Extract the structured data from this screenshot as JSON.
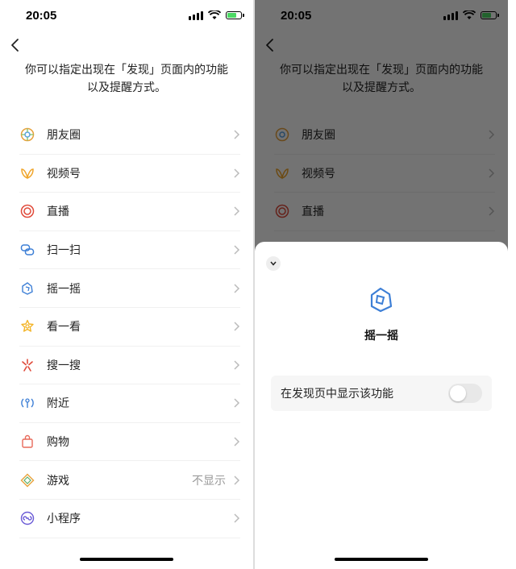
{
  "status_bar": {
    "time": "20:05"
  },
  "description": {
    "line1": "你可以指定出现在「发现」页面内的功能",
    "line2": "以及提醒方式。"
  },
  "features": [
    {
      "label": "朋友圈",
      "icon": "moments-icon",
      "value": ""
    },
    {
      "label": "视频号",
      "icon": "channels-icon",
      "value": ""
    },
    {
      "label": "直播",
      "icon": "live-icon",
      "value": ""
    },
    {
      "label": "扫一扫",
      "icon": "scan-icon",
      "value": ""
    },
    {
      "label": "摇一摇",
      "icon": "shake-icon",
      "value": ""
    },
    {
      "label": "看一看",
      "icon": "top-stories-icon",
      "value": ""
    },
    {
      "label": "搜一搜",
      "icon": "search-icon",
      "value": ""
    },
    {
      "label": "附近",
      "icon": "nearby-icon",
      "value": ""
    },
    {
      "label": "购物",
      "icon": "shopping-icon",
      "value": ""
    },
    {
      "label": "游戏",
      "icon": "games-icon",
      "value": "不显示"
    },
    {
      "label": "小程序",
      "icon": "mini-programs-icon",
      "value": ""
    }
  ],
  "sheet": {
    "title": "摇一摇",
    "toggle_label": "在发现页中显示该功能",
    "toggle_on": false
  },
  "colors": {
    "moments": "#e8a23c",
    "channels": "#f0a52b",
    "live": "#e04a3a",
    "scan": "#3d7fd6",
    "shake": "#3d7fd6",
    "top_stories": "#f3b52a",
    "search": "#e04a3a",
    "nearby": "#3d7fd6",
    "shopping": "#e86a5a",
    "games": "#e8a23c",
    "mini": "#6a5ad6"
  }
}
